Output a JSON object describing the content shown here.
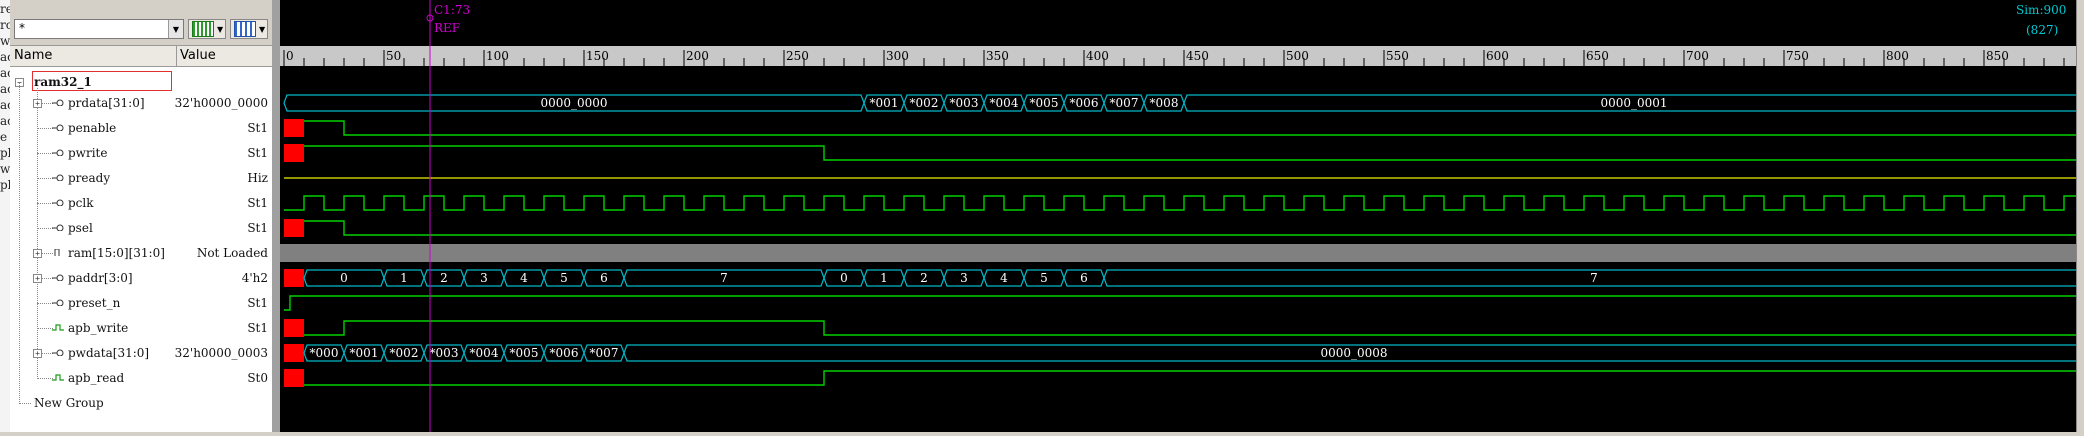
{
  "left_strip": [
    "re",
    "rc",
    "w",
    "ac",
    "ac",
    "ac",
    "ac",
    "ac",
    "e",
    "pl",
    "w",
    "pl"
  ],
  "toolbar": {
    "filter_value": "*"
  },
  "columns": {
    "name": "Name",
    "value": "Value"
  },
  "group": "ram32_1",
  "signals": [
    {
      "name": "prdata[31:0]",
      "value": "32'h0000_0000",
      "bus": true
    },
    {
      "name": "penable",
      "value": "St1"
    },
    {
      "name": "pwrite",
      "value": "St1"
    },
    {
      "name": "pready",
      "value": "Hiz"
    },
    {
      "name": "pclk",
      "value": "St1"
    },
    {
      "name": "psel",
      "value": "St1"
    },
    {
      "name": "ram[15:0][31:0]",
      "value": "Not Loaded",
      "bus": true
    },
    {
      "name": "paddr[3:0]",
      "value": "4'h2",
      "bus": true
    },
    {
      "name": "preset_n",
      "value": "St1"
    },
    {
      "name": "apb_write",
      "value": "St1"
    },
    {
      "name": "pwdata[31:0]",
      "value": "32'h0000_0003",
      "bus": true
    },
    {
      "name": "apb_read",
      "value": "St0"
    }
  ],
  "new_group": "New Group",
  "cursor": {
    "label": "C1:73",
    "ref_label": "REF",
    "time": 73
  },
  "sim": {
    "end_label": "Sim:900",
    "view_label": "(827)"
  },
  "timeline": {
    "ticks": [
      "0",
      "50",
      "100",
      "150",
      "200",
      "250",
      "300",
      "350",
      "400",
      "450",
      "500",
      "550",
      "600",
      "650",
      "700",
      "750",
      "800",
      "850"
    ],
    "range": [
      0,
      900
    ]
  },
  "waves": {
    "prdata": [
      {
        "t0": 0,
        "t1": 290,
        "label": "0000_0000"
      },
      {
        "t0": 290,
        "t1": 310,
        "label": "*001"
      },
      {
        "t0": 310,
        "t1": 330,
        "label": "*002"
      },
      {
        "t0": 330,
        "t1": 350,
        "label": "*003"
      },
      {
        "t0": 350,
        "t1": 370,
        "label": "*004"
      },
      {
        "t0": 370,
        "t1": 390,
        "label": "*005"
      },
      {
        "t0": 390,
        "t1": 410,
        "label": "*006"
      },
      {
        "t0": 410,
        "t1": 430,
        "label": "*007"
      },
      {
        "t0": 430,
        "t1": 450,
        "label": "*008"
      },
      {
        "t0": 450,
        "t1": 900,
        "label": "0000_0001"
      }
    ],
    "paddr": [
      {
        "t0": 0,
        "t1": 10,
        "label": "",
        "x": true
      },
      {
        "t0": 10,
        "t1": 50,
        "label": "0"
      },
      {
        "t0": 50,
        "t1": 70,
        "label": "1"
      },
      {
        "t0": 70,
        "t1": 90,
        "label": "2"
      },
      {
        "t0": 90,
        "t1": 110,
        "label": "3"
      },
      {
        "t0": 110,
        "t1": 130,
        "label": "4"
      },
      {
        "t0": 130,
        "t1": 150,
        "label": "5"
      },
      {
        "t0": 150,
        "t1": 170,
        "label": "6"
      },
      {
        "t0": 170,
        "t1": 270,
        "label": "7"
      },
      {
        "t0": 270,
        "t1": 290,
        "label": "0"
      },
      {
        "t0": 290,
        "t1": 310,
        "label": "1"
      },
      {
        "t0": 310,
        "t1": 330,
        "label": "2"
      },
      {
        "t0": 330,
        "t1": 350,
        "label": "3"
      },
      {
        "t0": 350,
        "t1": 370,
        "label": "4"
      },
      {
        "t0": 370,
        "t1": 390,
        "label": "5"
      },
      {
        "t0": 390,
        "t1": 410,
        "label": "6"
      },
      {
        "t0": 410,
        "t1": 900,
        "label": "7"
      }
    ],
    "pwdata": [
      {
        "t0": 0,
        "t1": 10,
        "label": "",
        "x": true
      },
      {
        "t0": 10,
        "t1": 30,
        "label": "*000"
      },
      {
        "t0": 30,
        "t1": 50,
        "label": "*001"
      },
      {
        "t0": 50,
        "t1": 70,
        "label": "*002"
      },
      {
        "t0": 70,
        "t1": 90,
        "label": "*003"
      },
      {
        "t0": 90,
        "t1": 110,
        "label": "*004"
      },
      {
        "t0": 110,
        "t1": 130,
        "label": "*005"
      },
      {
        "t0": 130,
        "t1": 150,
        "label": "*006"
      },
      {
        "t0": 150,
        "t1": 170,
        "label": "*007"
      },
      {
        "t0": 170,
        "t1": 900,
        "label": "0000_0008"
      }
    ]
  },
  "colors": {
    "wave_green": "#00d000",
    "wave_cyan": "#00b8c8",
    "x_red": "#ff0000",
    "hiz_yellow": "#c8c800",
    "cursor": "#d000d0",
    "ram_gray": "#808080"
  }
}
